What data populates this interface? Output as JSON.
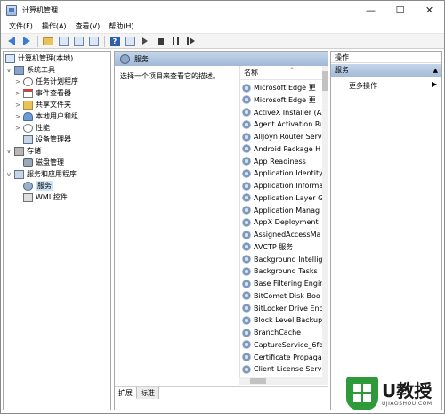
{
  "window": {
    "title": "计算机管理",
    "controls": {
      "minimize": "—",
      "maximize": "☐",
      "close": "✕"
    }
  },
  "menubar": [
    "文件(F)",
    "操作(A)",
    "查看(V)",
    "帮助(H)"
  ],
  "tree": [
    {
      "label": "计算机管理(本地)",
      "icon": "computer-icon",
      "expander": ""
    },
    {
      "label": "系统工具",
      "icon": "tools-icon",
      "expander": "v"
    },
    {
      "label": "任务计划程序",
      "icon": "clock-icon",
      "expander": ">"
    },
    {
      "label": "事件查看器",
      "icon": "event-log-icon",
      "expander": ">"
    },
    {
      "label": "共享文件夹",
      "icon": "folder-icon",
      "expander": ">"
    },
    {
      "label": "本地用户和组",
      "icon": "users-icon",
      "expander": ">"
    },
    {
      "label": "性能",
      "icon": "performance-icon",
      "expander": ">"
    },
    {
      "label": "设备管理器",
      "icon": "device-manager-icon",
      "expander": ""
    },
    {
      "label": "存储",
      "icon": "storage-icon",
      "expander": "v"
    },
    {
      "label": "磁盘管理",
      "icon": "disk-icon",
      "expander": ""
    },
    {
      "label": "服务和应用程序",
      "icon": "services-apps-icon",
      "expander": "v"
    },
    {
      "label": "服务",
      "icon": "gear-icon",
      "expander": "",
      "selected": true
    },
    {
      "label": "WMI 控件",
      "icon": "wmi-icon",
      "expander": ""
    }
  ],
  "middle": {
    "header": "服务",
    "description": "选择一个项目来查看它的描述。",
    "column_name": "名称",
    "services": [
      "Microsoft Edge 更",
      "Microsoft Edge 更",
      "ActiveX Installer (Ax",
      "Agent Activation Ru",
      "AllJoyn Router Serv",
      "Android Package H",
      "App Readiness",
      "Application Identity",
      "Application Informa",
      "Application Layer G",
      "Application Manag",
      "AppX Deployment",
      "AssignedAccessMa",
      "AVCTP 服务",
      "Background Intellig",
      "Background Tasks",
      "Base Filtering Engir",
      "BitComet Disk Boo",
      "BitLocker Drive Enc",
      "Block Level Backup",
      "BranchCache",
      "CaptureService_6fe",
      "Certificate Propaga",
      "Client License Servi"
    ],
    "tabs": {
      "extended": "扩展",
      "standard": "标准"
    }
  },
  "actions": {
    "title": "操作",
    "section": "服务",
    "more": "更多操作"
  },
  "watermark": {
    "big": "U教授",
    "small": "UJIAOSHOU.COM"
  }
}
